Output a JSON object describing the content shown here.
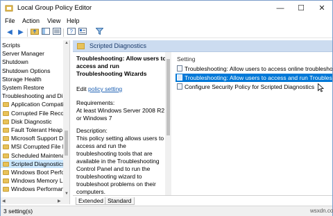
{
  "window": {
    "title": "Local Group Policy Editor",
    "controls": {
      "minimize": "—",
      "maximize": "☐",
      "close": "✕"
    }
  },
  "menu": [
    "File",
    "Action",
    "View",
    "Help"
  ],
  "toolbar": [
    "back-icon",
    "forward-icon",
    "folder-up-icon",
    "show-hide-tree-icon",
    "export-list-icon",
    "help-icon",
    "properties-icon",
    "filter-icon"
  ],
  "tree": {
    "items": [
      {
        "label": "Scripts",
        "folder": false
      },
      {
        "label": "Server Manager",
        "folder": false
      },
      {
        "label": "Shutdown",
        "folder": false
      },
      {
        "label": "Shutdown Options",
        "folder": false
      },
      {
        "label": "Storage Health",
        "folder": false
      },
      {
        "label": "System Restore",
        "folder": false
      },
      {
        "label": "Troubleshooting and Di",
        "folder": false
      },
      {
        "label": "Application Compatibi",
        "folder": true
      },
      {
        "label": "Corrupted File Recove",
        "folder": true
      },
      {
        "label": "Disk Diagnostic",
        "folder": true
      },
      {
        "label": "Fault Tolerant Heap",
        "folder": true
      },
      {
        "label": "Microsoft Support Dia",
        "folder": true
      },
      {
        "label": "MSI Corrupted File Re",
        "folder": true
      },
      {
        "label": "Scheduled Maintenan",
        "folder": true
      },
      {
        "label": "Scripted Diagnostics",
        "folder": true,
        "selected": true
      },
      {
        "label": "Windows Boot Perfor",
        "folder": true
      },
      {
        "label": "Windows Memory Lea",
        "folder": true
      },
      {
        "label": "Windows Performanc",
        "folder": true
      }
    ]
  },
  "header": {
    "title": "Scripted Diagnostics"
  },
  "description": {
    "title": "Troubleshooting: Allow users to access and run Troubleshooting Wizards",
    "edit_prefix": "Edit ",
    "edit_link": "policy setting",
    "requirements": "Requirements:\nAt least Windows Server 2008 R2 or Windows 7",
    "body": "Description:\nThis policy setting allows users to access and run the troubleshooting tools that are available in the Troubleshooting Control Panel and to run the troubleshooting wizard to troubleshoot problems on their computers."
  },
  "list": {
    "column": "Setting",
    "rows": [
      {
        "label": "Troubleshooting: Allow users to access online troubleshooting"
      },
      {
        "label": "Troubleshooting: Allow users to access and run Troubleshooting",
        "selected": true
      },
      {
        "label": "Configure Security Policy for Scripted Diagnostics"
      }
    ]
  },
  "tabs": [
    "Extended",
    "Standard"
  ],
  "status": {
    "text": "3 setting(s)"
  },
  "watermark": "wsxdn.com",
  "colors": {
    "selection": "#0078d7",
    "header_band": "#ccdcf0",
    "folder": "#e8c25a",
    "link": "#1b5fb3"
  }
}
